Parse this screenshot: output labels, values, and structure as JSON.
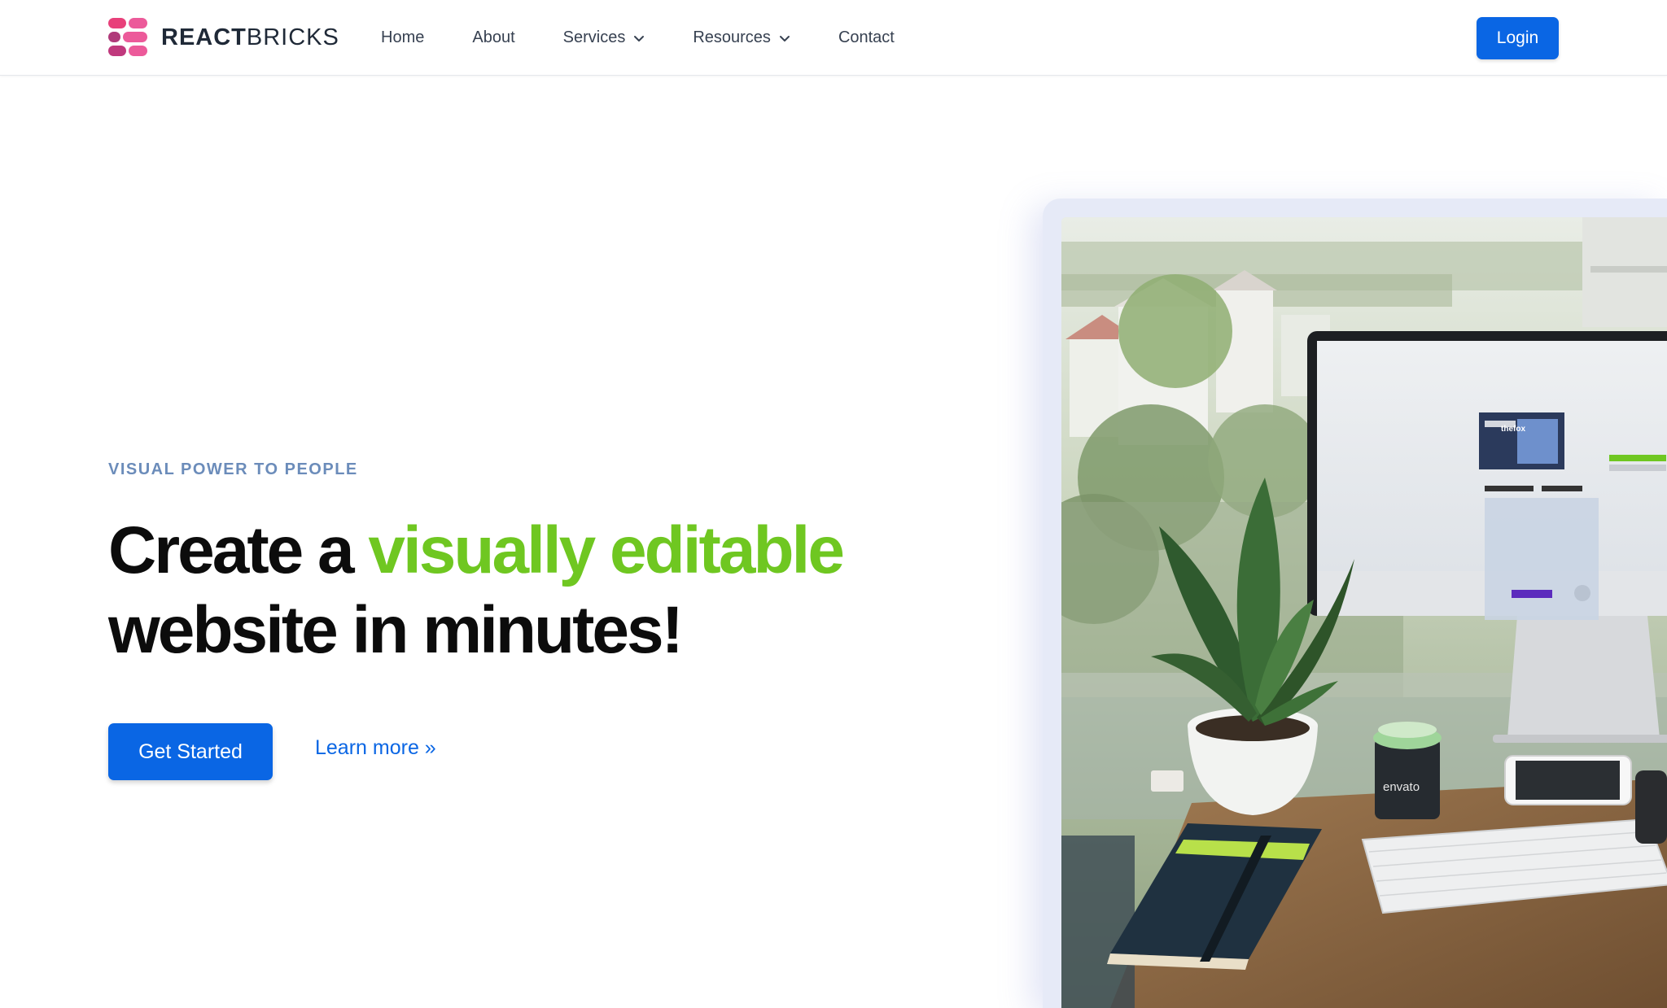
{
  "brand": {
    "name_bold": "REACT",
    "name_regular": "BRICKS",
    "logo_icon": "bricks-logo-icon",
    "colors": [
      "#e8407a",
      "#ec5a9a",
      "#b03a7a"
    ]
  },
  "nav": {
    "items": [
      {
        "label": "Home",
        "has_dropdown": false
      },
      {
        "label": "About",
        "has_dropdown": false
      },
      {
        "label": "Services",
        "has_dropdown": true
      },
      {
        "label": "Resources",
        "has_dropdown": true
      },
      {
        "label": "Contact",
        "has_dropdown": false
      }
    ],
    "login_label": "Login"
  },
  "hero": {
    "eyebrow": "VISUAL POWER TO PEOPLE",
    "headline_part1": "Create a ",
    "headline_accent": "visually editable",
    "headline_part2": "website in minutes!",
    "primary_cta": "Get Started",
    "secondary_cta": "Learn more »",
    "image_alt": "Desk with iMac, plant, notebook, keyboard, phone and coffee cup",
    "image_text": {
      "screen_brand": "thefox",
      "cup_brand": "envato"
    }
  },
  "colors": {
    "accent_blue": "#0a66e4",
    "accent_green": "#6fc721",
    "eyebrow": "#6b8cba"
  }
}
